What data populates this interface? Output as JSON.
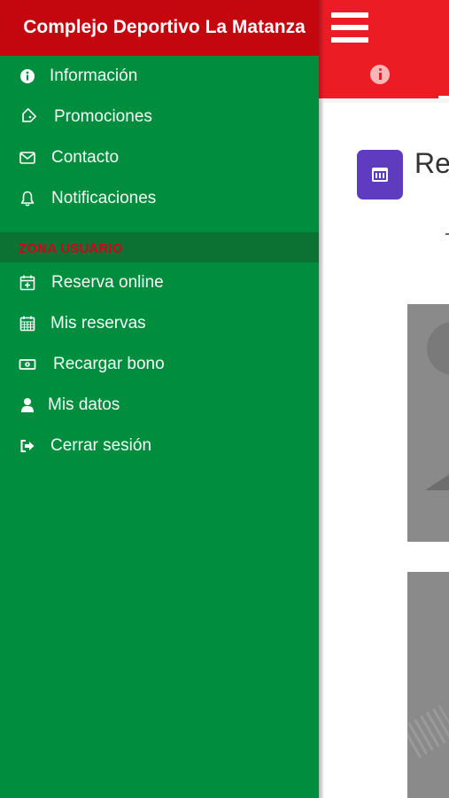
{
  "drawer": {
    "title": "Complejo Deportivo La Matanza",
    "items": [
      {
        "label": "Información",
        "icon": "info-circle-icon"
      },
      {
        "label": "Promociones",
        "icon": "tag-icon"
      },
      {
        "label": "Contacto",
        "icon": "envelope-icon"
      },
      {
        "label": "Notificaciones",
        "icon": "bell-icon"
      }
    ],
    "section_title": "ZONA USUARIO",
    "user_items": [
      {
        "label": "Reserva online",
        "icon": "calendar-plus-icon"
      },
      {
        "label": "Mis reservas",
        "icon": "calendar-icon"
      },
      {
        "label": "Recargar bono",
        "icon": "money-bill-icon"
      },
      {
        "label": "Mis datos",
        "icon": "user-icon"
      },
      {
        "label": "Cerrar sesión",
        "icon": "sign-out-icon"
      }
    ]
  },
  "app": {
    "menu_icon": "hamburger-menu-icon",
    "tab_icon": "info-tab-icon",
    "section_title_partial": "Res"
  },
  "colors": {
    "drawer_bg": "#008d3e",
    "drawer_header_bg": "#c4060e",
    "section_bg": "#0c7233",
    "section_text": "#d7001a",
    "app_header_bg": "#ec1c24",
    "accent_purple": "#5e3bbf"
  }
}
